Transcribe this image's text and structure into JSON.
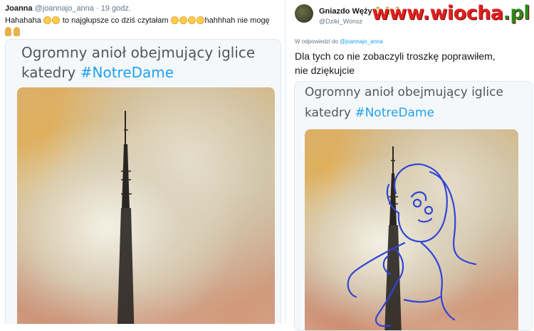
{
  "left_tweet": {
    "name": "Joanna",
    "handle": "@joannajo_anna",
    "time": "· 19 godz.",
    "text_before": "Hahahaha",
    "text_middle": "to najgłupsze co dziś czytałam",
    "text_after": "hahhhah nie mogę",
    "image": {
      "caption_line1": "Ogromny anioł obejmujący iglice",
      "caption_word": "katedry",
      "caption_hashtag": "#NotreDame"
    }
  },
  "right_tweet": {
    "name": "Gniazdo Węży",
    "handle": "@Dziki_Wonsz",
    "reply_prefix": "W odpowiedzi do",
    "reply_to": "@joannajo_anna",
    "text_line1": "Dla tych co nie zobaczyli troszkę poprawiłem,",
    "text_line2": "nie dziękujcie",
    "image": {
      "caption_line1": "Ogromny anioł obejmujący iglice",
      "caption_word": "katedry",
      "caption_hashtag": "#NotreDame"
    }
  },
  "watermark": {
    "www": "www.",
    "brand": "wiocha",
    "tld": ".pl"
  },
  "icons": {
    "laugh": "rolling-on-floor-laughing-emoji",
    "person": "woman-facepalming-emoji",
    "snake": "snake-emoji"
  },
  "colors": {
    "accent": "#1da1f2",
    "drawing": "#2f45d6",
    "watermark_red": "#e0201e",
    "watermark_green": "#2a8a1a"
  }
}
